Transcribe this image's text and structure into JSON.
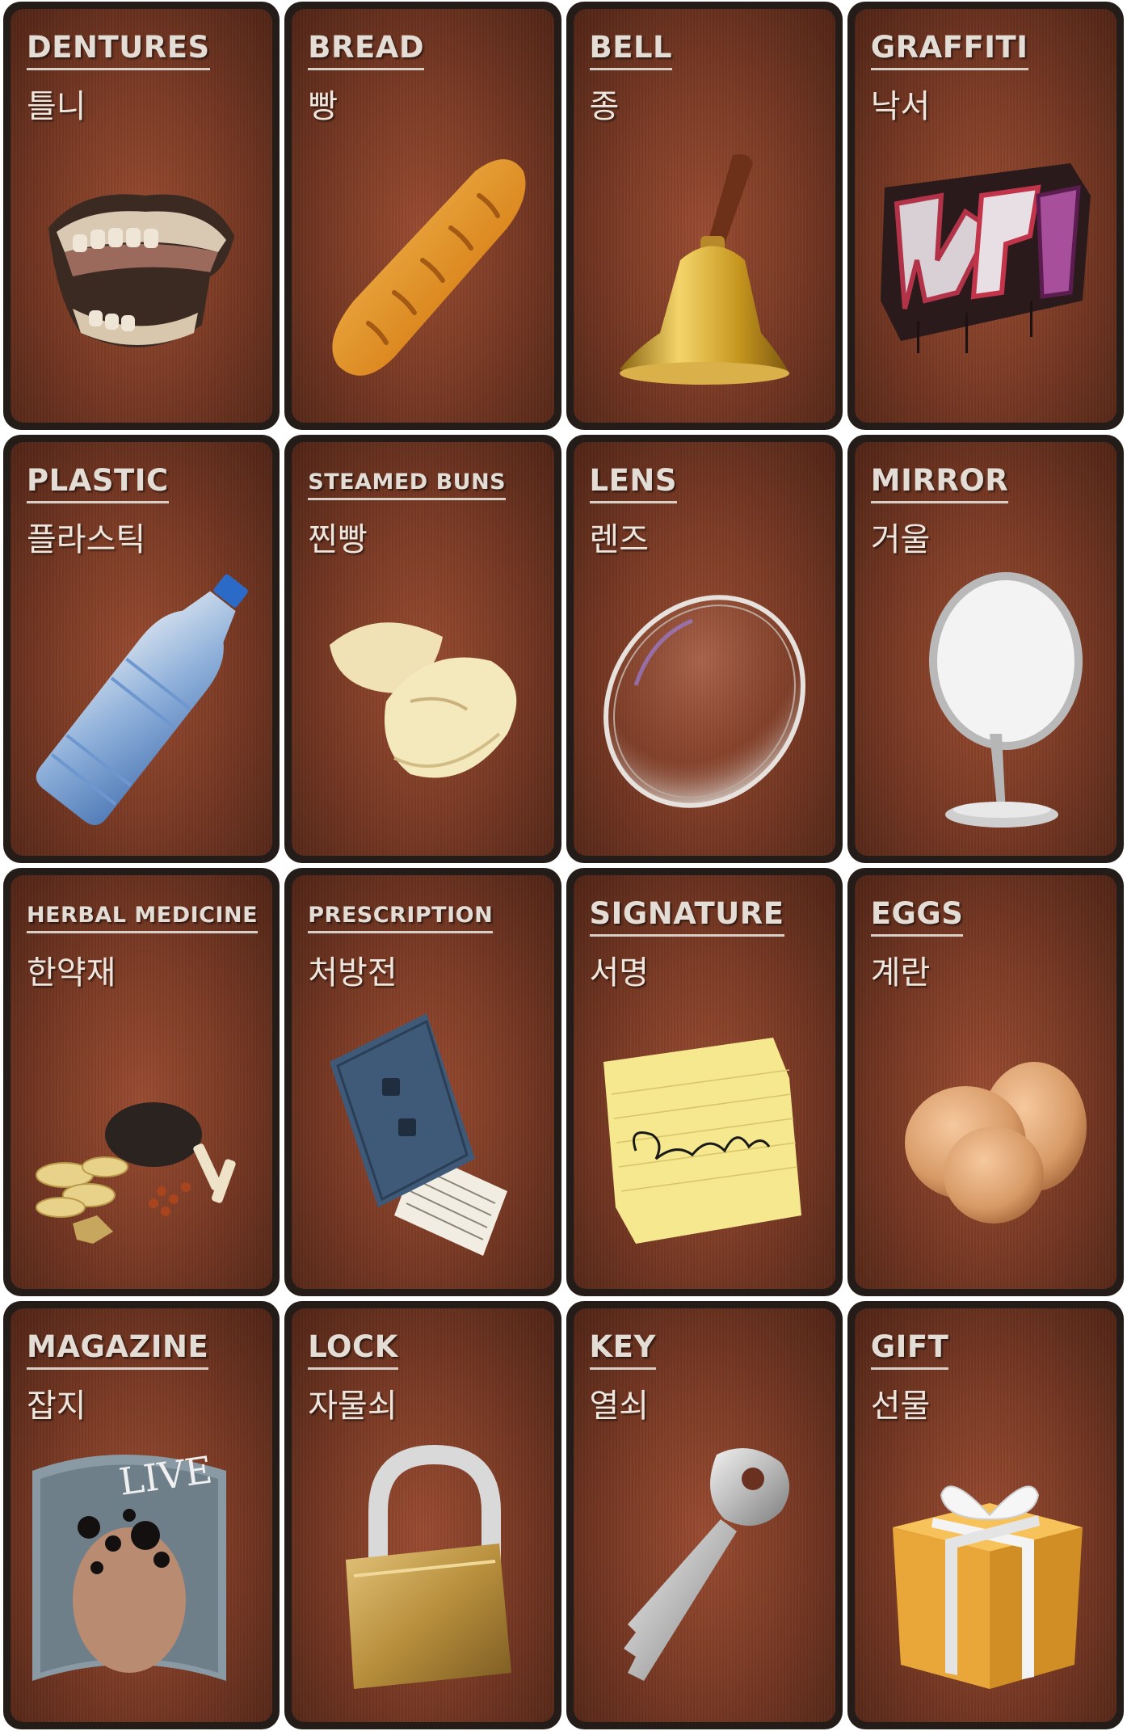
{
  "cards": [
    {
      "en": "DENTURES",
      "ko": "틀니",
      "icon": "dentures-icon"
    },
    {
      "en": "BREAD",
      "ko": "빵",
      "icon": "bread-icon"
    },
    {
      "en": "BELL",
      "ko": "종",
      "icon": "bell-icon"
    },
    {
      "en": "GRAFFITI",
      "ko": "낙서",
      "icon": "graffiti-icon"
    },
    {
      "en": "PLASTIC",
      "ko": "플라스틱",
      "icon": "plastic-bottle-icon"
    },
    {
      "en": "STEAMED BUNS",
      "ko": "찐빵",
      "icon": "steamed-buns-icon"
    },
    {
      "en": "LENS",
      "ko": "렌즈",
      "icon": "lens-icon"
    },
    {
      "en": "MIRROR",
      "ko": "거울",
      "icon": "mirror-icon"
    },
    {
      "en": "HERBAL MEDICINE",
      "ko": "한약재",
      "icon": "herbal-medicine-icon"
    },
    {
      "en": "PRESCRIPTION",
      "ko": "처방전",
      "icon": "prescription-icon"
    },
    {
      "en": "SIGNATURE",
      "ko": "서명",
      "icon": "signature-icon"
    },
    {
      "en": "EGGS",
      "ko": "계란",
      "icon": "eggs-icon"
    },
    {
      "en": "MAGAZINE",
      "ko": "잡지",
      "icon": "magazine-icon"
    },
    {
      "en": "LOCK",
      "ko": "자물쇠",
      "icon": "padlock-icon"
    },
    {
      "en": "KEY",
      "ko": "열쇠",
      "icon": "key-icon"
    },
    {
      "en": "GIFT",
      "ko": "선물",
      "icon": "gift-box-icon"
    }
  ],
  "magazine_cover_text": "LIVE",
  "colors": {
    "card_border": "#231c19",
    "card_background": "#7c3b25",
    "title_text": "#e4ddd6"
  }
}
